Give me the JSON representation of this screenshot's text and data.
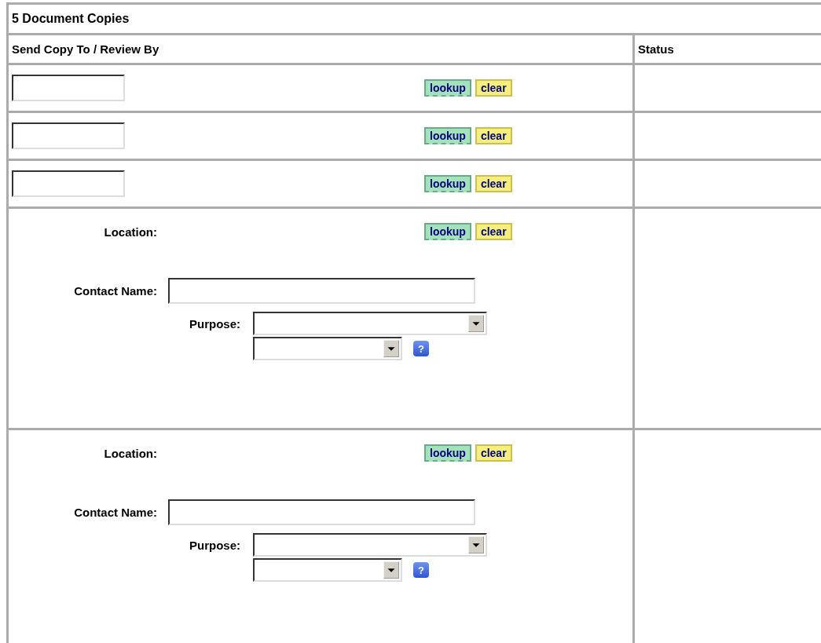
{
  "title": "5 Document Copies",
  "columns": [
    "Send Copy To / Review By",
    "Status"
  ],
  "rows": [
    {
      "kind": "simple",
      "lookup": "lookup",
      "clear": "clear"
    },
    {
      "kind": "simple",
      "lookup": "lookup",
      "clear": "clear"
    },
    {
      "kind": "simple",
      "lookup": "lookup",
      "clear": "clear"
    },
    {
      "kind": "location",
      "location_label": "Location:",
      "lookup": "lookup",
      "clear": "clear",
      "contact_label": "Contact Name:",
      "purpose_label": "Purpose:",
      "help": "?"
    },
    {
      "kind": "location",
      "location_label": "Location:",
      "lookup": "lookup",
      "clear": "clear",
      "contact_label": "Contact Name:",
      "purpose_label": "Purpose:",
      "help": "?"
    }
  ]
}
